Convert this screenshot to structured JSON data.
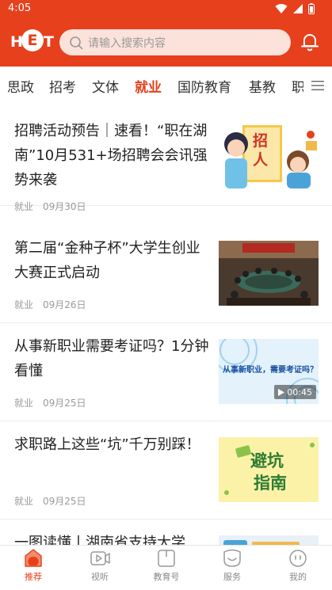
{
  "status": {
    "time": "4:05",
    "icons": [
      "wifi-icon",
      "signal-icon",
      "battery-icon"
    ]
  },
  "header": {
    "logo": {
      "text_left": "H",
      "text_center": "E",
      "text_right": "T"
    },
    "search": {
      "placeholder": "请输入搜索内容",
      "icon": "search-icon"
    },
    "notification_icon": "bell-icon",
    "brand_color": "#e6401d"
  },
  "tabs": {
    "items": [
      {
        "label": "思政"
      },
      {
        "label": "招考"
      },
      {
        "label": "文体"
      },
      {
        "label": "就业",
        "active": true
      },
      {
        "label": "国防教育"
      },
      {
        "label": "基教"
      },
      {
        "label": "职"
      }
    ],
    "menu_icon": "menu-icon"
  },
  "articles": [
    {
      "title": "招聘活动预告｜速看！“职在湖南”10月531+场招聘会会讯强势来袭",
      "category": "就业",
      "date": "09月30日",
      "thumb_text": "招人"
    },
    {
      "title": "第二届“金种子杯”大学生创业大赛正式启动",
      "category": "就业",
      "date": "09月26日"
    },
    {
      "title": "从事新职业需要考证吗？1分钟看懂",
      "category": "就业",
      "date": "09月25日",
      "thumb_text": "从事新职业，需要考证吗？",
      "duration": "00:45"
    },
    {
      "title": "求职路上这些“坑”千万别踩！",
      "category": "就业",
      "date": "09月25日",
      "thumb_text_1": "避坑",
      "thumb_text_2": "指南"
    },
    {
      "title": "一图读懂丨湖南省支持大学"
    }
  ],
  "bottom_nav": [
    {
      "label": "推荐",
      "icon": "home-icon",
      "active": true
    },
    {
      "label": "视听",
      "icon": "video-icon"
    },
    {
      "label": "教育号",
      "icon": "book-icon"
    },
    {
      "label": "服务",
      "icon": "service-icon"
    },
    {
      "label": "我的",
      "icon": "profile-icon"
    }
  ]
}
